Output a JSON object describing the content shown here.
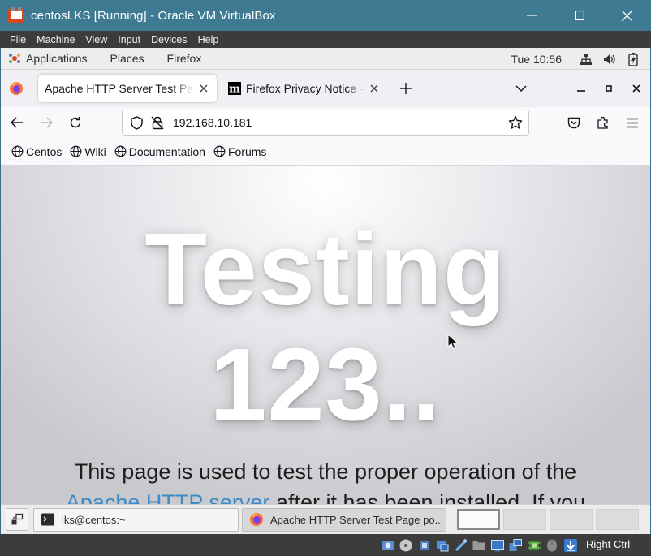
{
  "vbox": {
    "title": "centosLKS [Running] - Oracle VM VirtualBox",
    "menu": [
      "File",
      "Machine",
      "View",
      "Input",
      "Devices",
      "Help"
    ],
    "host_key": "Right Ctrl"
  },
  "gnome_panel": {
    "applications": "Applications",
    "places": "Places",
    "firefox": "Firefox",
    "clock": "Tue 10:56"
  },
  "firefox": {
    "tabs": [
      {
        "label": "Apache HTTP Server Test Page powered by CentOS",
        "favicon": "blank-page-icon",
        "active": true
      },
      {
        "label": "Firefox Privacy Notice — Mozilla",
        "favicon": "mozilla-m-icon",
        "active": false
      }
    ],
    "url": "192.168.10.181",
    "bookmarks": [
      "Centos",
      "Wiki",
      "Documentation",
      "Forums"
    ]
  },
  "page": {
    "heading_line1": "Testing",
    "heading_line2": "123..",
    "para_line1": "This page is used to test the proper operation of the",
    "para_link": "Apache HTTP server",
    "para_line2_rest": " after it has been installed. If you"
  },
  "taskbar": {
    "terminal_task": "lks@centos:~",
    "firefox_task": "Apache HTTP Server Test Page po..."
  },
  "colors": {
    "vbox_titlebar": "#3f7a93",
    "link": "#3c8dc7"
  }
}
